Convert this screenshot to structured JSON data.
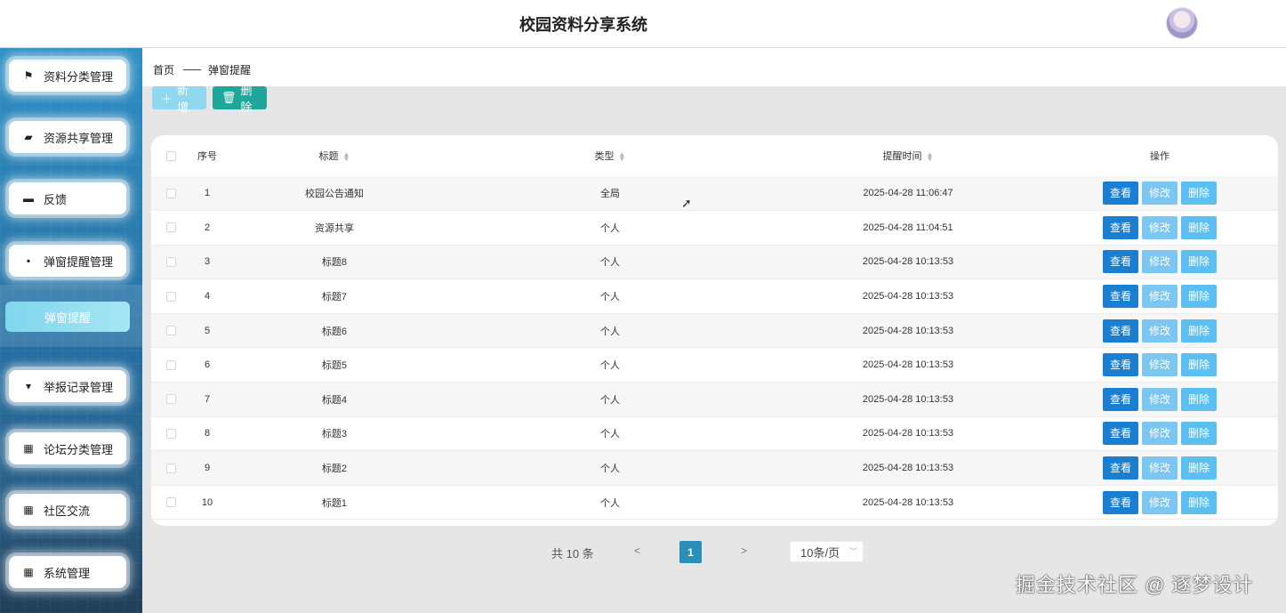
{
  "header": {
    "title": "校园资料分享系统"
  },
  "sidebar": {
    "items": [
      {
        "label": "资料分类管理",
        "icon": "flag-icon",
        "glyph": "⚑"
      },
      {
        "label": "资源共享管理",
        "icon": "wallet-icon",
        "glyph": "▰"
      },
      {
        "label": "反馈",
        "icon": "monitor-icon",
        "glyph": "▬"
      },
      {
        "label": "弹窗提醒管理",
        "icon": "comment-icon",
        "glyph": "▪"
      },
      {
        "label": "举报记录管理",
        "icon": "signpost-icon",
        "glyph": "▾"
      },
      {
        "label": "论坛分类管理",
        "icon": "grid-icon",
        "glyph": "▦"
      },
      {
        "label": "社区交流",
        "icon": "grid-icon",
        "glyph": "▦"
      },
      {
        "label": "系统管理",
        "icon": "grid-icon",
        "glyph": "▦"
      }
    ],
    "active_sub": "弹窗提醒"
  },
  "breadcrumb": {
    "home": "首页",
    "current": "弹窗提醒"
  },
  "toolbar": {
    "add_label": "新增",
    "delete_label": "删除"
  },
  "table": {
    "headers": {
      "index": "序号",
      "title": "标题",
      "type": "类型",
      "time": "提醒时间",
      "ops": "操作"
    },
    "rows": [
      {
        "index": "1",
        "title": "校园公告通知",
        "type": "全局",
        "time": "2025-04-28 11:06:47"
      },
      {
        "index": "2",
        "title": "资源共享",
        "type": "个人",
        "time": "2025-04-28 11:04:51"
      },
      {
        "index": "3",
        "title": "标题8",
        "type": "个人",
        "time": "2025-04-28 10:13:53"
      },
      {
        "index": "4",
        "title": "标题7",
        "type": "个人",
        "time": "2025-04-28 10:13:53"
      },
      {
        "index": "5",
        "title": "标题6",
        "type": "个人",
        "time": "2025-04-28 10:13:53"
      },
      {
        "index": "6",
        "title": "标题5",
        "type": "个人",
        "time": "2025-04-28 10:13:53"
      },
      {
        "index": "7",
        "title": "标题4",
        "type": "个人",
        "time": "2025-04-28 10:13:53"
      },
      {
        "index": "8",
        "title": "标题3",
        "type": "个人",
        "time": "2025-04-28 10:13:53"
      },
      {
        "index": "9",
        "title": "标题2",
        "type": "个人",
        "time": "2025-04-28 10:13:53"
      },
      {
        "index": "10",
        "title": "标题1",
        "type": "个人",
        "time": "2025-04-28 10:13:53"
      }
    ],
    "ops": {
      "view": "查看",
      "edit": "修改",
      "delete": "删除"
    }
  },
  "pagination": {
    "total": "共 10 条",
    "prev": "<",
    "page": "1",
    "next": ">",
    "page_size": "10条/页"
  },
  "watermark": "掘金技术社区 @ 逐梦设计",
  "colors": {
    "primary": "#1a7fd0",
    "accent": "#1fa89a",
    "sidebar": "#2a7db0"
  }
}
